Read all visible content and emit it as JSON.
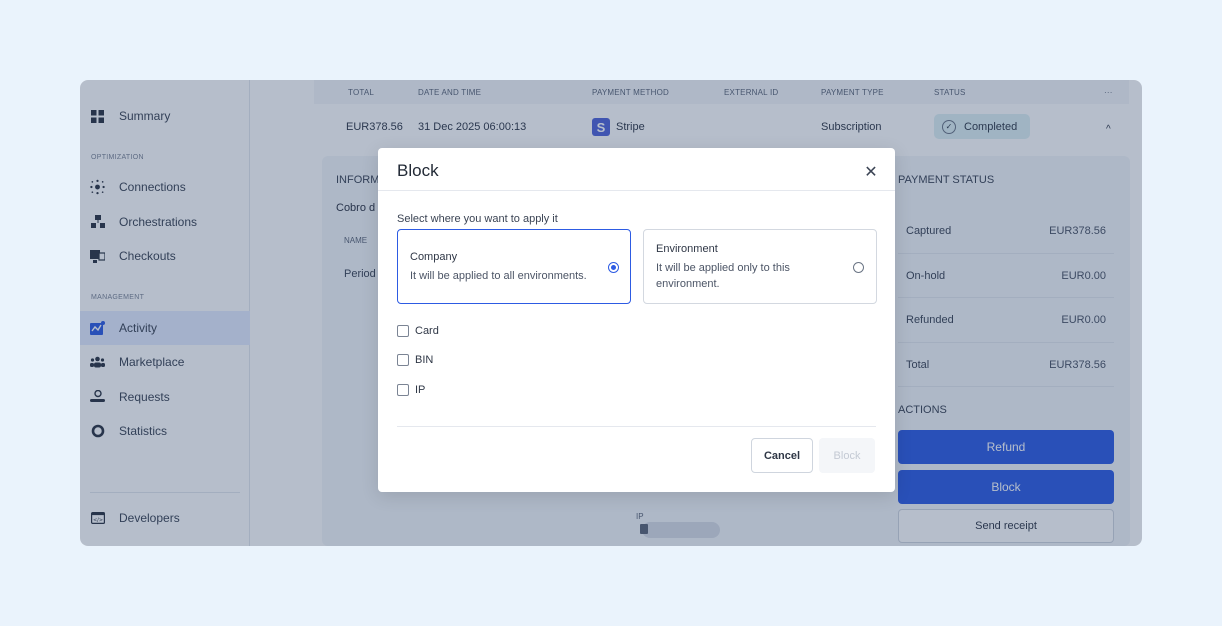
{
  "sidebar": {
    "items": [
      {
        "label": "Summary",
        "icon": "grid-icon"
      },
      {
        "label": "Connections",
        "icon": "network-icon"
      },
      {
        "label": "Orchestrations",
        "icon": "hierarchy-icon"
      },
      {
        "label": "Checkouts",
        "icon": "checkout-icon"
      },
      {
        "label": "Activity",
        "icon": "activity-icon"
      },
      {
        "label": "Marketplace",
        "icon": "people-icon"
      },
      {
        "label": "Requests",
        "icon": "requests-icon"
      },
      {
        "label": "Statistics",
        "icon": "statistics-icon"
      },
      {
        "label": "Developers",
        "icon": "code-icon"
      }
    ],
    "sections": {
      "optimization": "OPTIMIZATION",
      "management": "MANAGEMENT"
    }
  },
  "table": {
    "headers": {
      "total": "TOTAL",
      "date": "DATE AND TIME",
      "method": "PAYMENT METHOD",
      "external": "EXTERNAL ID",
      "type": "PAYMENT TYPE",
      "status": "STATUS",
      "more": "···"
    },
    "row": {
      "total": "EUR378.56",
      "date": "31 Dec 2025 06:00:13",
      "method_badge": "S",
      "method": "Stripe",
      "type": "Subscription",
      "status": "Completed",
      "toggle": "^"
    }
  },
  "detail": {
    "info_title": "INFORM",
    "info_sub": "Cobro d",
    "name_header": "NAME",
    "period": "Period",
    "ip_label": "IP",
    "payment_status_title": "PAYMENT STATUS",
    "status_rows": [
      {
        "label": "Captured",
        "value": "EUR378.56"
      },
      {
        "label": "On-hold",
        "value": "EUR0.00"
      },
      {
        "label": "Refunded",
        "value": "EUR0.00"
      },
      {
        "label": "Total",
        "value": "EUR378.56"
      }
    ],
    "actions_title": "ACTIONS",
    "refund": "Refund",
    "block": "Block",
    "send_receipt": "Send receipt"
  },
  "modal": {
    "title": "Block",
    "close": "✕",
    "apply_label": "Select where you want to apply it",
    "options": [
      {
        "title": "Company",
        "desc": "It will be applied to all environments.",
        "selected": true
      },
      {
        "title": "Environment",
        "desc": "It will be applied only to this environment.",
        "selected": false
      }
    ],
    "checkboxes": [
      "Card",
      "BIN",
      "IP"
    ],
    "cancel": "Cancel",
    "block": "Block"
  },
  "colors": {
    "accent": "#2d5be3",
    "completed_bg": "#dff0f4",
    "page_bg": "#eaf3fc"
  }
}
